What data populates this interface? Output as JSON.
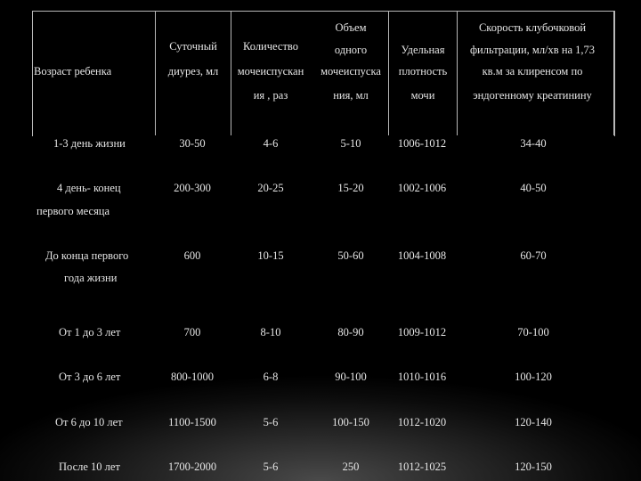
{
  "header": {
    "age": "Возраст ребенка",
    "daily": [
      "Суточный",
      "диурез, мл"
    ],
    "count": [
      "Количество",
      "мочеиспускан",
      "ия , раз"
    ],
    "volume": [
      "Объем",
      "одного",
      "мочеиспуска",
      "ния, мл"
    ],
    "density": [
      "Удельная",
      "плотность",
      "мочи"
    ],
    "gfr": [
      "Скорость клубочковой",
      "фильтрации, мл/хв на 1,73",
      "кв.м за клиренсом по",
      "эндогенному креатинину"
    ]
  },
  "rows": [
    {
      "age": [
        "1-3 день жизни"
      ],
      "daily": "30-50",
      "count": "4-6",
      "volume": "5-10",
      "density": "1006-1012",
      "gfr": "34-40"
    },
    {
      "age": [
        "4 день- конец",
        "первого месяца"
      ],
      "daily": "200-300",
      "count": "20-25",
      "volume": "15-20",
      "density": "1002-1006",
      "gfr": "40-50"
    },
    {
      "age": [
        "До конца первого",
        "года жизни"
      ],
      "daily": "600",
      "count": "10-15",
      "volume": "50-60",
      "density": "1004-1008",
      "gfr": "60-70"
    },
    {
      "age": [
        "От 1 до 3 лет"
      ],
      "daily": "700",
      "count": "8-10",
      "volume": "80-90",
      "density": "1009-1012",
      "gfr": "70-100"
    },
    {
      "age": [
        "От 3 до 6 лет"
      ],
      "daily": "800-1000",
      "count": "6-8",
      "volume": "90-100",
      "density": "1010-1016",
      "gfr": "100-120"
    },
    {
      "age": [
        "От 6 до 10 лет"
      ],
      "daily": "1100-1500",
      "count": "5-6",
      "volume": "100-150",
      "density": "1012-1020",
      "gfr": "120-140"
    },
    {
      "age": [
        "После 10 лет"
      ],
      "daily": "1700-2000",
      "count": "5-6",
      "volume": "250",
      "density": "1012-1025",
      "gfr": "120-150"
    }
  ]
}
